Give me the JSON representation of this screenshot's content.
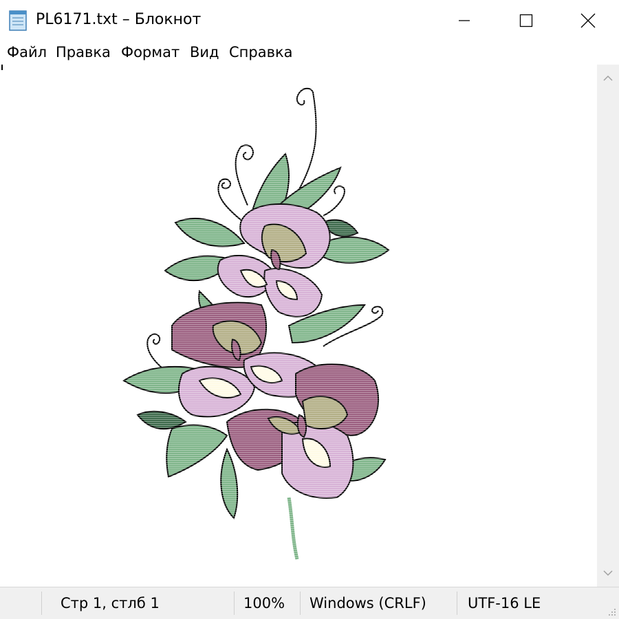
{
  "window": {
    "title": "PL6171.txt – Блокнот",
    "controls": {
      "minimize": "minimize",
      "maximize": "maximize",
      "close": "close"
    }
  },
  "menu": {
    "items": [
      "Файл",
      "Правка",
      "Формат",
      "Вид",
      "Справка"
    ]
  },
  "editor": {
    "content_description": "ASCII-art rendering of a flower bouquet"
  },
  "statusbar": {
    "position": "Стр 1, стлб 1",
    "zoom": "100%",
    "line_endings": "Windows (CRLF)",
    "encoding": "UTF-16 LE"
  },
  "colors": {
    "leaf_green": "#7fb58a",
    "leaf_dark": "#3f6b4d",
    "petal_light": "#d7b2d6",
    "petal_dark": "#9b5f80",
    "cream": "#fffbe6",
    "olive": "#b2ae85"
  }
}
